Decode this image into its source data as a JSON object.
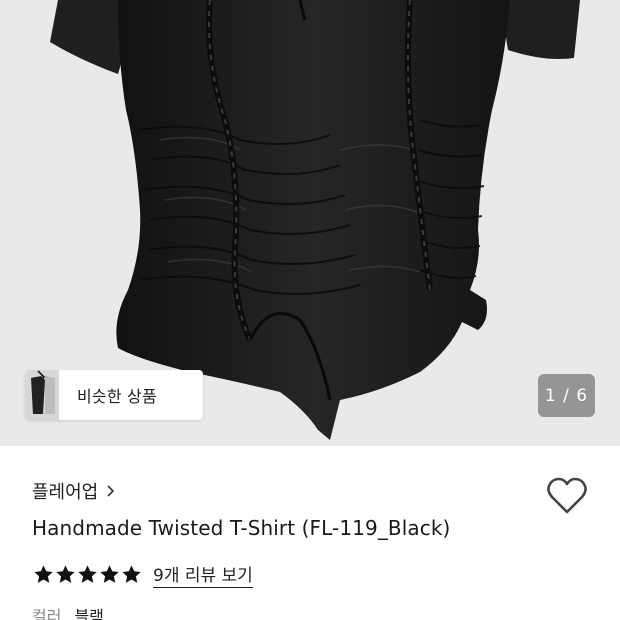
{
  "gallery": {
    "counter": "1 / 6",
    "similar_button_label": "비슷한 상품"
  },
  "product": {
    "brand": "플레어업",
    "title": "Handmade Twisted T-Shirt (FL-119_Black)",
    "rating_stars": 5,
    "review_link": "9개 리뷰 보기",
    "color_label": "컬러",
    "color_value": "블랙"
  },
  "icons": {
    "brand_chevron": "chevron-right-icon",
    "similar_chevron": "chevron-right-icon",
    "wishlist": "heart-outline-icon",
    "star": "star-filled-icon"
  },
  "colors": {
    "image_background": "#e9e9e9",
    "garment": "#1d1d1d",
    "counter_background": "#7a7a7a"
  }
}
